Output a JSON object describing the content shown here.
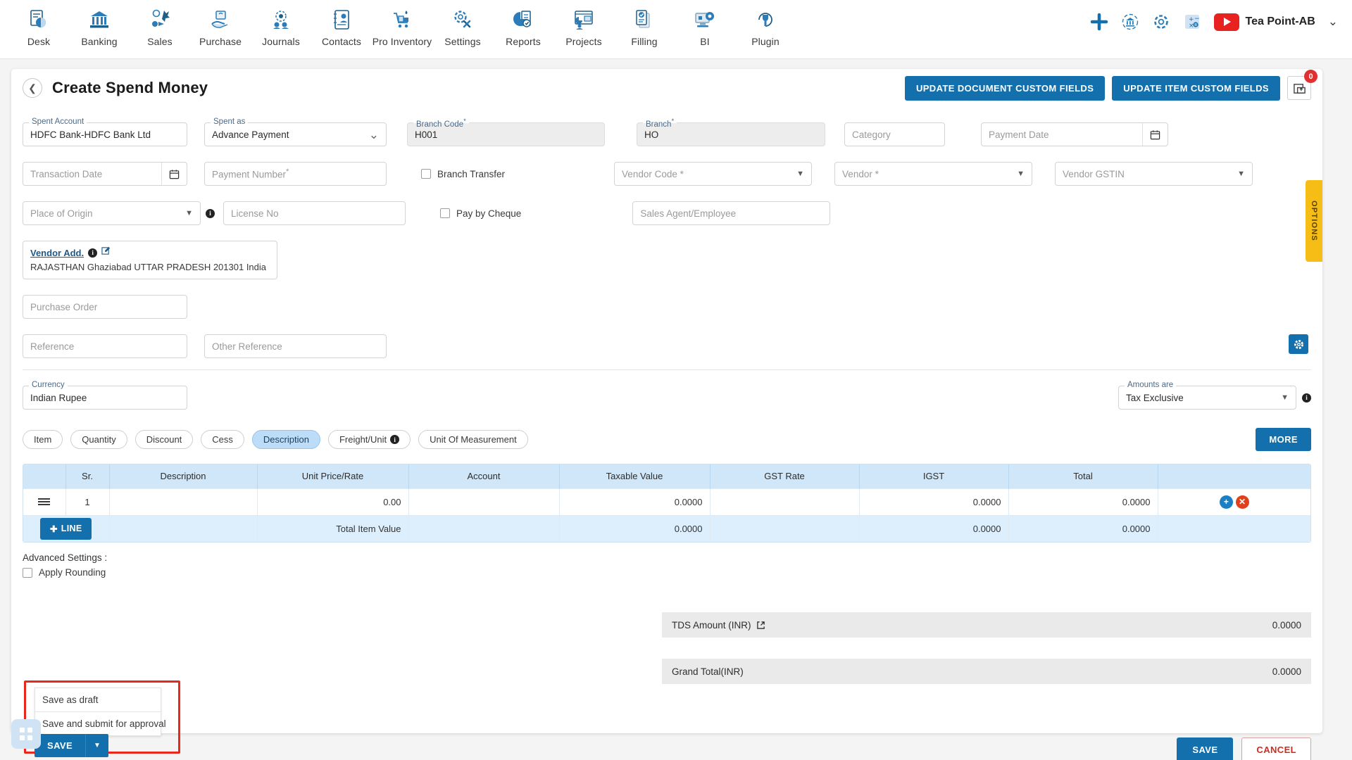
{
  "topnav": {
    "items": [
      {
        "label": "Desk",
        "icon": "desk-icon"
      },
      {
        "label": "Banking",
        "icon": "bank-icon"
      },
      {
        "label": "Sales",
        "icon": "sales-icon"
      },
      {
        "label": "Purchase",
        "icon": "purchase-icon"
      },
      {
        "label": "Journals",
        "icon": "journals-icon"
      },
      {
        "label": "Contacts",
        "icon": "contacts-icon"
      },
      {
        "label": "Pro Inventory",
        "icon": "inventory-icon"
      },
      {
        "label": "Settings",
        "icon": "settings-icon"
      },
      {
        "label": "Reports",
        "icon": "reports-icon"
      },
      {
        "label": "Projects",
        "icon": "projects-icon"
      },
      {
        "label": "Filling",
        "icon": "filling-icon"
      },
      {
        "label": "BI",
        "icon": "bi-icon"
      },
      {
        "label": "Plugin",
        "icon": "plugin-icon"
      }
    ],
    "right": {
      "add_icon": "plus-icon",
      "bank_sync_icon": "bank-refresh-icon",
      "settings_icon": "gear-icon",
      "calculator_icon": "calculator-icon",
      "video_icon": "youtube-icon",
      "org_name": "Tea Point-AB",
      "chevron": "chevron-down-icon"
    }
  },
  "header": {
    "back_icon": "chevron-left-icon",
    "title": "Create Spend Money",
    "update_document_custom_fields": "UPDATE DOCUMENT CUSTOM FIELDS",
    "update_item_custom_fields": "UPDATE ITEM CUSTOM FIELDS",
    "upload_icon": "upload-attachment-icon",
    "attachment_count": "0"
  },
  "options_tab": {
    "label": "OPTIONS"
  },
  "form": {
    "spent_account": {
      "label": "Spent Account",
      "value": "HDFC Bank-HDFC Bank Ltd"
    },
    "spent_as": {
      "label": "Spent as",
      "value": "Advance Payment"
    },
    "branch_code": {
      "label": "Branch Code",
      "required": "*",
      "value": "H001"
    },
    "branch": {
      "label": "Branch",
      "required": "*",
      "value": "HO"
    },
    "category": {
      "placeholder": "Category"
    },
    "payment_date": {
      "placeholder": "Payment Date",
      "icon": "calendar-icon"
    },
    "transaction_date": {
      "placeholder": "Transaction Date",
      "icon": "calendar-icon"
    },
    "payment_number": {
      "placeholder": "Payment Number",
      "required": "*"
    },
    "branch_transfer": {
      "label": "Branch Transfer",
      "checked": false
    },
    "vendor_code": {
      "placeholder": "Vendor Code *"
    },
    "vendor": {
      "placeholder": "Vendor *"
    },
    "vendor_gstin": {
      "placeholder": "Vendor GSTIN"
    },
    "place_of_origin": {
      "placeholder": "Place of Origin"
    },
    "license_no": {
      "placeholder": "License No"
    },
    "pay_by_cheque": {
      "label": "Pay by Cheque",
      "checked": false
    },
    "sales_agent": {
      "placeholder": "Sales Agent/Employee"
    },
    "vendor_address": {
      "link": "Vendor Add.",
      "info_icon": "info-icon",
      "edit_icon": "edit-icon",
      "text": "RAJASTHAN Ghaziabad UTTAR PRADESH 201301 India"
    },
    "purchase_order": {
      "placeholder": "Purchase Order"
    },
    "reference": {
      "placeholder": "Reference"
    },
    "other_reference": {
      "placeholder": "Other Reference"
    },
    "currency": {
      "label": "Currency",
      "value": "Indian Rupee"
    },
    "amounts_are": {
      "label": "Amounts are",
      "value": "Tax Exclusive",
      "info_icon": "info-icon"
    },
    "settings_gear": {
      "icon": "gear-icon"
    }
  },
  "chips": {
    "items": [
      {
        "label": "Item",
        "selected": false,
        "info": false
      },
      {
        "label": "Quantity",
        "selected": false,
        "info": false
      },
      {
        "label": "Discount",
        "selected": false,
        "info": false
      },
      {
        "label": "Cess",
        "selected": false,
        "info": false
      },
      {
        "label": "Description",
        "selected": true,
        "info": false
      },
      {
        "label": "Freight/Unit",
        "selected": false,
        "info": true
      },
      {
        "label": "Unit Of Measurement",
        "selected": false,
        "info": false
      }
    ],
    "more_label": "MORE"
  },
  "table": {
    "columns": [
      "",
      "Sr.",
      "Description",
      "Unit Price/Rate",
      "Account",
      "Taxable Value",
      "GST Rate",
      "IGST",
      "Total",
      ""
    ],
    "rows": [
      {
        "handle": "drag-handle-icon",
        "sr": "1",
        "description": "",
        "unit_price": "0.00",
        "account": "",
        "taxable_value": "0.0000",
        "gst_rate": "",
        "igst": "0.0000",
        "total": "0.0000",
        "add_icon": "add-row-icon",
        "delete_icon": "delete-row-icon"
      }
    ],
    "footer": {
      "line_button": "LINE",
      "line_icon": "plus-circle-icon",
      "total_label": "Total Item Value",
      "taxable_value": "0.0000",
      "gst_rate": "",
      "igst": "0.0000",
      "total": "0.0000"
    }
  },
  "advanced": {
    "title": "Advanced Settings :",
    "apply_rounding": {
      "label": "Apply Rounding",
      "checked": false
    }
  },
  "totals": [
    {
      "label": "TDS Amount (INR)",
      "icon": "external-link-icon",
      "amount": "0.0000"
    },
    {
      "label": "Grand Total(INR)",
      "icon": "",
      "amount": "0.0000"
    }
  ],
  "save_menu": {
    "items": [
      "Save as draft",
      "Save and submit for approval"
    ],
    "save_label": "SAVE",
    "caret_icon": "caret-down-icon"
  },
  "bottom_actions": {
    "save": "SAVE",
    "cancel": "CANCEL"
  },
  "fab": {
    "icon": "apps-grid-icon"
  },
  "colors": {
    "primary": "#1470ad",
    "accent_yellow": "#f6bd16",
    "danger": "#e8271d",
    "table_header": "#cfe7f9"
  }
}
